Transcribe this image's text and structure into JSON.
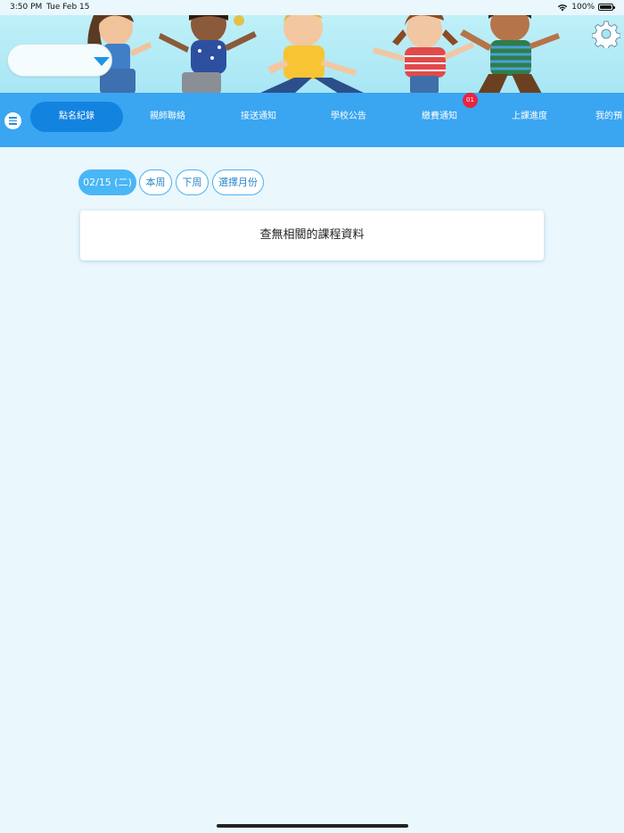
{
  "status_bar": {
    "time": "3:50 PM",
    "date": "Tue Feb 15",
    "battery": "100%",
    "wifi_icon": "wifi-icon",
    "battery_icon": "battery-icon"
  },
  "header": {
    "settings_icon": "gear-icon",
    "class_selector_value": ""
  },
  "nav": {
    "menu_icon": "hamburger-icon",
    "tabs": [
      {
        "label": "點名紀錄",
        "active": true
      },
      {
        "label": "親師聯絡"
      },
      {
        "label": "接送通知"
      },
      {
        "label": "學校公告"
      },
      {
        "label": "繳費通知",
        "badge": "01"
      },
      {
        "label": "上課進度"
      },
      {
        "label": "我的預"
      }
    ]
  },
  "filters": {
    "current_date": "02/15 (二)",
    "this_week": "本周",
    "next_week": "下周",
    "select_month": "選擇月份"
  },
  "content": {
    "empty_message": "查無相關的課程資料"
  },
  "colors": {
    "nav_bg": "#3aa5f1",
    "active_tab": "#1383e0",
    "badge": "#e8243f",
    "page_bg": "#eaf7fd"
  }
}
